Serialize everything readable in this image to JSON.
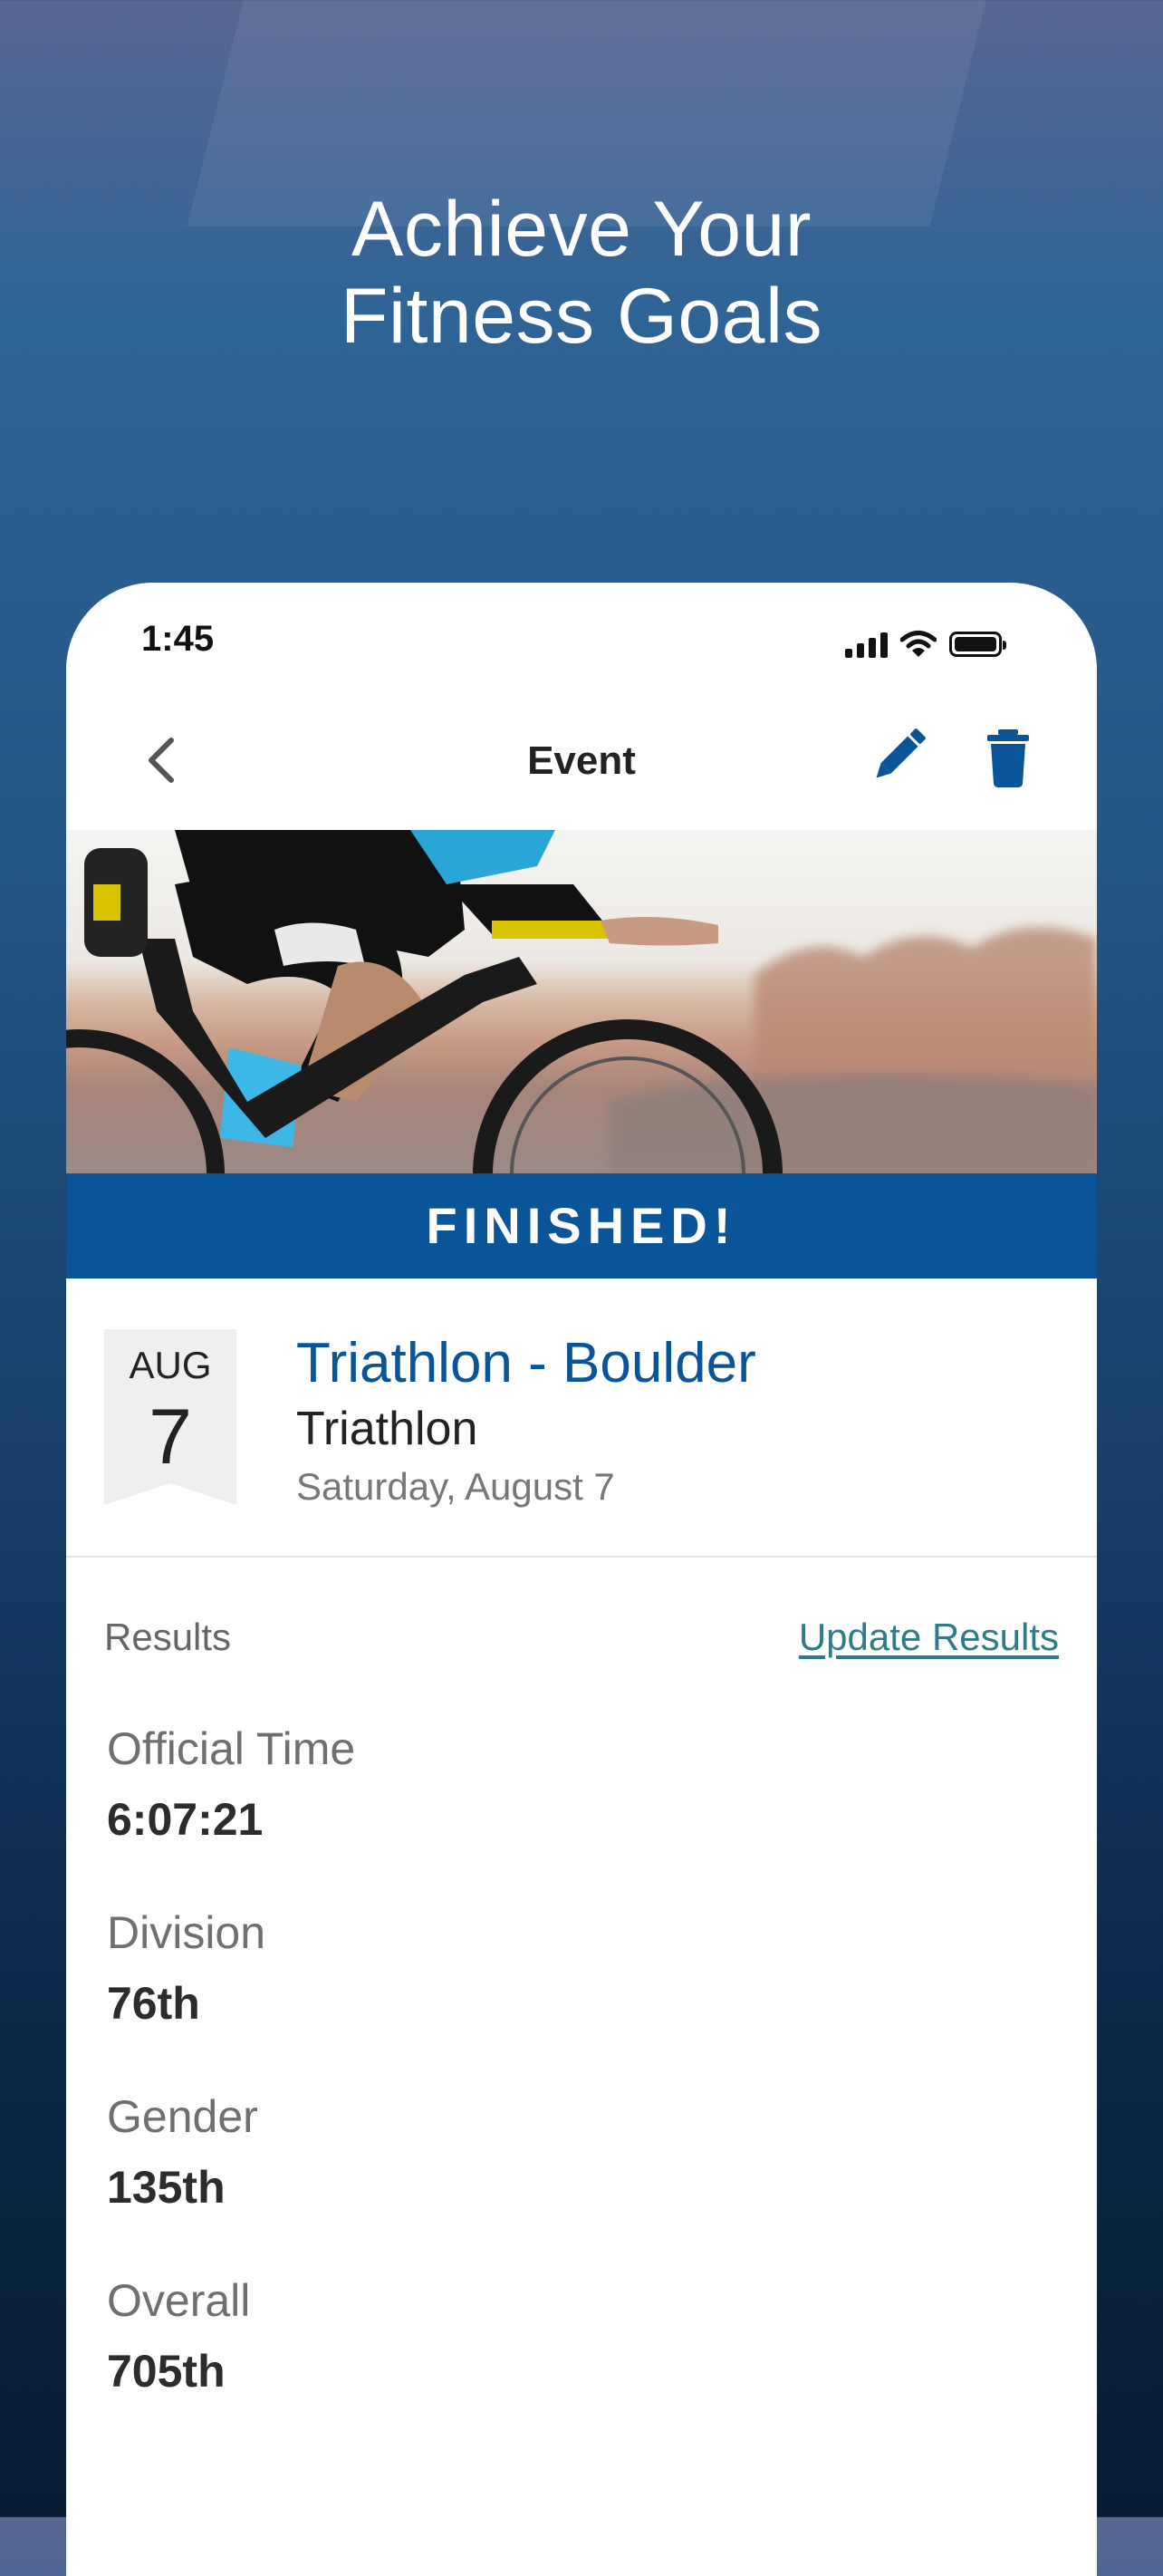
{
  "headline": {
    "line1": "Achieve Your",
    "line2": "Fitness Goals"
  },
  "status_bar": {
    "time": "1:45"
  },
  "nav": {
    "title": "Event"
  },
  "banner": {
    "label": "FINISHED!"
  },
  "event": {
    "month": "AUG",
    "day": "7",
    "name": "Triathlon - Boulder",
    "type": "Triathlon",
    "date": "Saturday, August 7"
  },
  "results": {
    "label": "Results",
    "update_label": "Update Results",
    "items": [
      {
        "label": "Official Time",
        "value": "6:07:21"
      },
      {
        "label": "Division",
        "value": "76th"
      },
      {
        "label": "Gender",
        "value": "135th"
      },
      {
        "label": "Overall",
        "value": "705th"
      }
    ]
  },
  "colors": {
    "accent": "#0a5499",
    "link": "#2f7b86"
  }
}
